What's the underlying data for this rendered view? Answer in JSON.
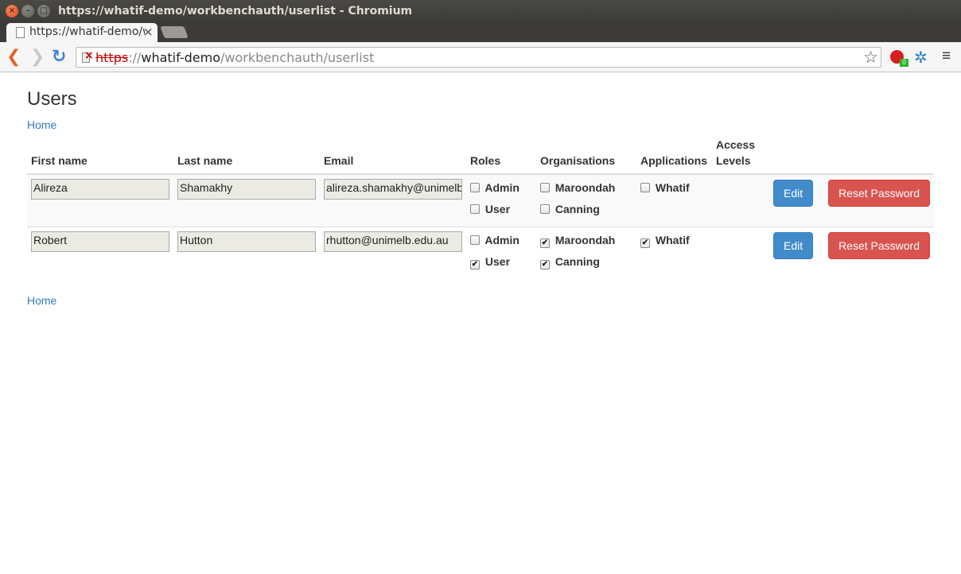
{
  "window": {
    "title": "https://whatif-demo/workbenchauth/userlist - Chromium"
  },
  "tab": {
    "title": "https://whatif-demo/workbenchauth/userlist",
    "close_glyph": "×"
  },
  "address": {
    "scheme": "https",
    "separator": "://",
    "host": "whatif-demo",
    "path": "/workbenchauth/userlist"
  },
  "extensions": {
    "badge_count": "0"
  },
  "page": {
    "title": "Users",
    "home_link_top": "Home",
    "home_link_bottom": "Home"
  },
  "table": {
    "headers": {
      "first_name": "First name",
      "last_name": "Last name",
      "email": "Email",
      "roles": "Roles",
      "organisations": "Organisations",
      "applications": "Applications",
      "access_levels": "Access Levels"
    },
    "rows": [
      {
        "first_name": "Alireza",
        "last_name": "Shamakhy",
        "email": "alireza.shamakhy@unimelb",
        "roles": [
          {
            "label": "Admin",
            "checked": false
          },
          {
            "label": "User",
            "checked": false
          }
        ],
        "organisations": [
          {
            "label": "Maroondah",
            "checked": false
          },
          {
            "label": "Canning",
            "checked": false
          }
        ],
        "applications": [
          {
            "label": "Whatif",
            "checked": false
          }
        ],
        "edit_label": "Edit",
        "reset_label": "Reset Password"
      },
      {
        "first_name": "Robert",
        "last_name": "Hutton",
        "email": "rhutton@unimelb.edu.au",
        "roles": [
          {
            "label": "Admin",
            "checked": false
          },
          {
            "label": "User",
            "checked": true
          }
        ],
        "organisations": [
          {
            "label": "Maroondah",
            "checked": true
          },
          {
            "label": "Canning",
            "checked": true
          }
        ],
        "applications": [
          {
            "label": "Whatif",
            "checked": true
          }
        ],
        "edit_label": "Edit",
        "reset_label": "Reset Password"
      }
    ]
  },
  "colors": {
    "link": "#337ab7",
    "edit_button": "#428bca",
    "reset_button": "#d9534f"
  }
}
